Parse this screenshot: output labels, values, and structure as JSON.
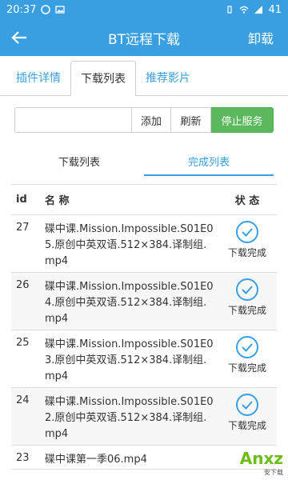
{
  "status_bar": {
    "time": "20:37",
    "battery": "41"
  },
  "app_bar": {
    "title": "BT远程下载",
    "uninstall_label": "卸载"
  },
  "tabs": [
    {
      "label": "插件详情"
    },
    {
      "label": "下载列表"
    },
    {
      "label": "推荐影片"
    }
  ],
  "toolbar": {
    "input_value": "",
    "add_label": "添加",
    "refresh_label": "刷新",
    "stop_label": "停止服务"
  },
  "subtabs": [
    {
      "label": "下载列表"
    },
    {
      "label": "完成列表"
    }
  ],
  "table": {
    "headers": {
      "id": "id",
      "name": "名 称",
      "status": "状 态"
    },
    "rows": [
      {
        "id": "27",
        "name": "碟中课.Mission.Impossible.S01E05.原创中英双语.512×384.译制组.mp4",
        "status": "下载完成"
      },
      {
        "id": "26",
        "name": "碟中课.Mission.Impossible.S01E04.原创中英双语.512×384.译制组.mp4",
        "status": "下载完成"
      },
      {
        "id": "25",
        "name": "碟中课.Mission.Impossible.S01E03.原创中英双语.512×384.译制组.mp4",
        "status": "下载完成"
      },
      {
        "id": "24",
        "name": "碟中课.Mission.Impossible.S01E02.原创中英双语.512×384.译制组.mp4",
        "status": "下载完成"
      },
      {
        "id": "23",
        "name": "碟中课第一季06.mp4",
        "status": ""
      }
    ]
  },
  "watermark": {
    "text": "Anxz",
    "sub": "安下载"
  },
  "colors": {
    "primary": "#3a9fe0",
    "success": "#5cb85c"
  }
}
